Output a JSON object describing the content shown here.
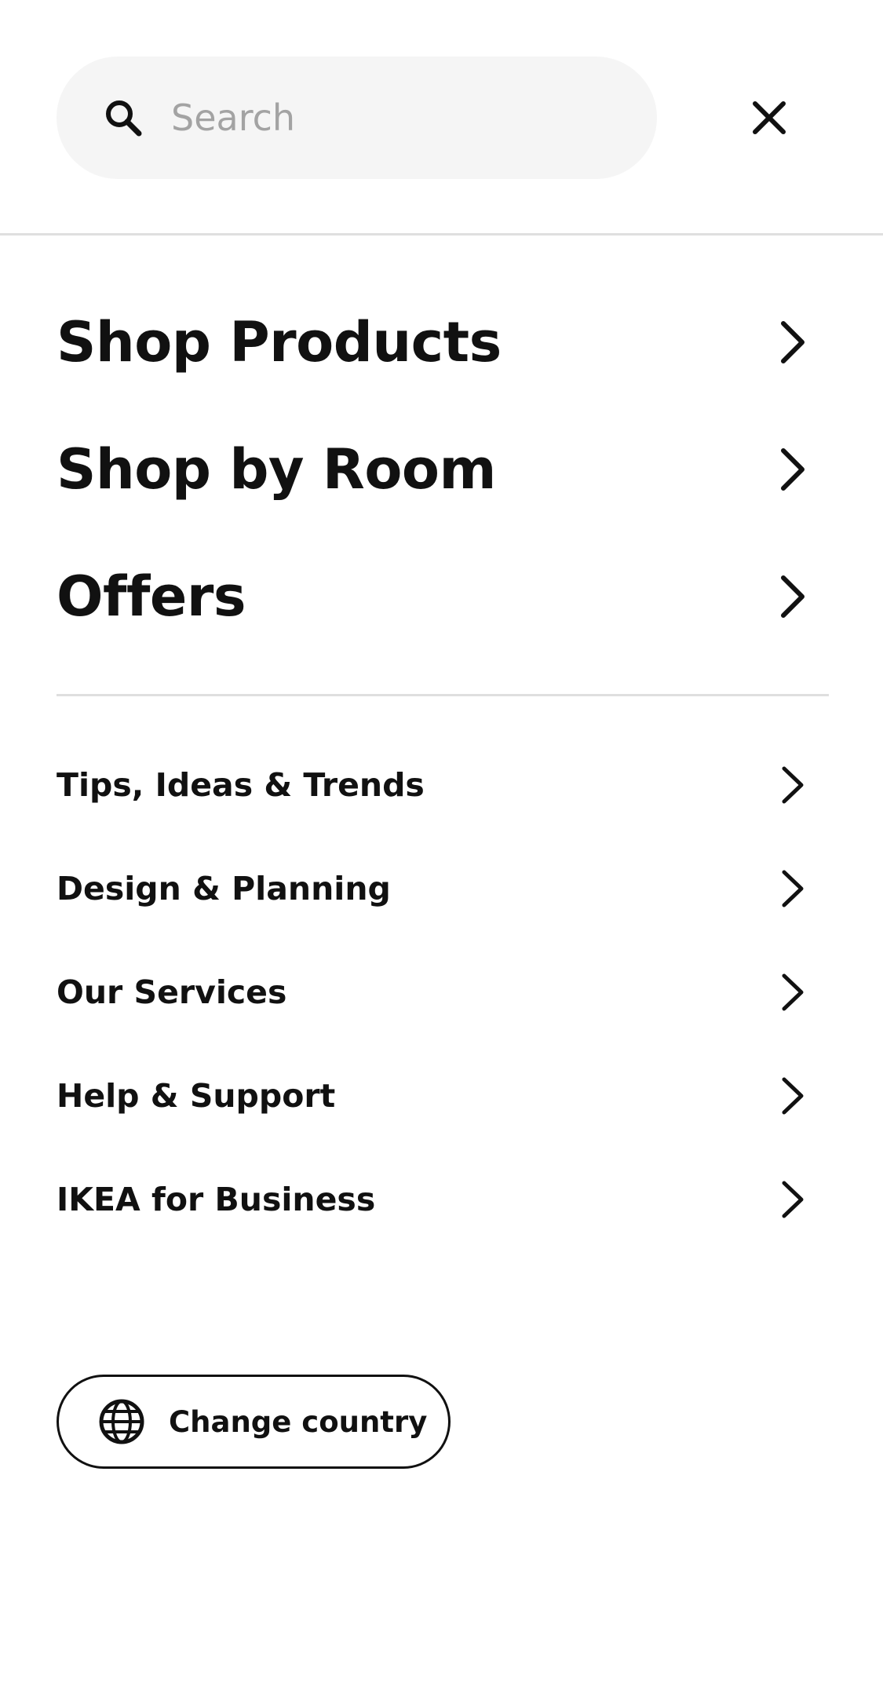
{
  "search": {
    "placeholder": "Search",
    "value": "",
    "icon": "search-icon"
  },
  "header": {
    "close_icon": "close-icon"
  },
  "primary_nav": {
    "items": [
      {
        "label": "Shop Products",
        "icon": "chevron-right-icon"
      },
      {
        "label": "Shop by Room",
        "icon": "chevron-right-icon"
      },
      {
        "label": "Offers",
        "icon": "chevron-right-icon"
      }
    ]
  },
  "secondary_nav": {
    "items": [
      {
        "label": "Tips, Ideas & Trends",
        "icon": "chevron-right-icon"
      },
      {
        "label": "Design & Planning",
        "icon": "chevron-right-icon"
      },
      {
        "label": "Our Services",
        "icon": "chevron-right-icon"
      },
      {
        "label": "Help & Support",
        "icon": "chevron-right-icon"
      },
      {
        "label": "IKEA for Business",
        "icon": "chevron-right-icon"
      }
    ]
  },
  "country": {
    "label": "Change country",
    "icon": "globe-icon"
  },
  "colors": {
    "text": "#111111",
    "search_bg": "#f5f5f5",
    "placeholder": "#a3a3a3",
    "divider": "#dfdfdf",
    "background": "#ffffff"
  }
}
